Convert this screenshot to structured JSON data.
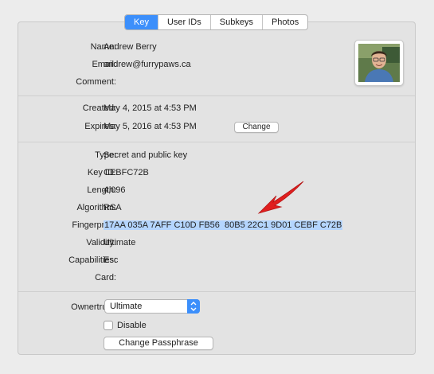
{
  "tabs": [
    {
      "label": "Key",
      "active": true
    },
    {
      "label": "User IDs",
      "active": false
    },
    {
      "label": "Subkeys",
      "active": false
    },
    {
      "label": "Photos",
      "active": false
    }
  ],
  "identity": {
    "name_label": "Name:",
    "name_value": "Andrew Berry",
    "email_label": "Email:",
    "email_value": "andrew@furrypaws.ca",
    "comment_label": "Comment:",
    "comment_value": ""
  },
  "dates": {
    "created_label": "Created:",
    "created_value": "May 4, 2015 at 4:53 PM",
    "expires_label": "Expires:",
    "expires_value": "May 5, 2016 at 4:53 PM",
    "change_button": "Change"
  },
  "details": {
    "type_label": "Type:",
    "type_value": "Secret and public key",
    "keyid_label": "Key ID:",
    "keyid_value": "CEBFC72B",
    "length_label": "Length:",
    "length_value": "4,096",
    "algorithm_label": "Algorithm:",
    "algorithm_value": "RSA",
    "fingerprint_label": "Fingerprint:",
    "fingerprint_value": "17AA 035A 7AFF C10D FB56  80B5 22C1 9D01 CEBF C72B",
    "validity_label": "Validity:",
    "validity_value": "Ultimate",
    "capabilities_label": "Capabilities:",
    "capabilities_value": "Esc",
    "card_label": "Card:",
    "card_value": ""
  },
  "trust": {
    "ownertrust_label": "Ownertrust:",
    "ownertrust_value": "Ultimate",
    "disable_label": "Disable",
    "disable_checked": false,
    "change_passphrase_button": "Change Passphrase"
  },
  "colors": {
    "accent": "#3c8ffb",
    "selection": "#b4d5fe",
    "annotation_arrow": "#e01f1f"
  },
  "icons": {
    "photo": "user-photo",
    "select_arrow": "chevron-updown-icon",
    "annotation": "red-arrow-icon"
  }
}
